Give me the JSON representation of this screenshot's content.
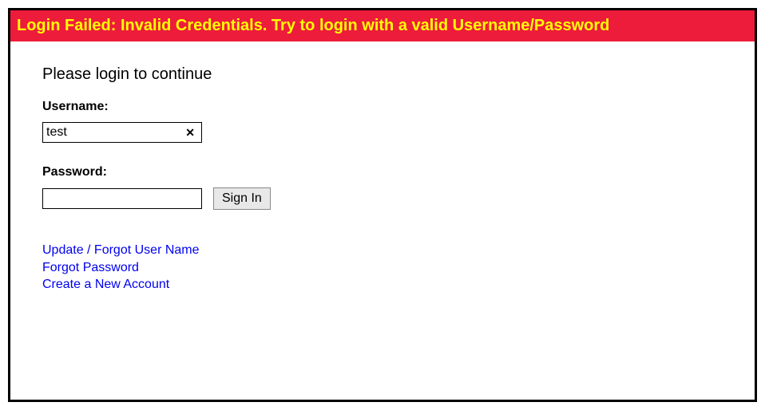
{
  "error_banner": "Login Failed: Invalid Credentials. Try to login with a valid Username/Password",
  "prompt": "Please login to continue",
  "username": {
    "label": "Username:",
    "value": "test"
  },
  "password": {
    "label": "Password:",
    "value": ""
  },
  "signin_label": "Sign In",
  "links": {
    "update_username": "Update / Forgot User Name",
    "forgot_password": "Forgot Password",
    "create_account": "Create a New Account"
  }
}
